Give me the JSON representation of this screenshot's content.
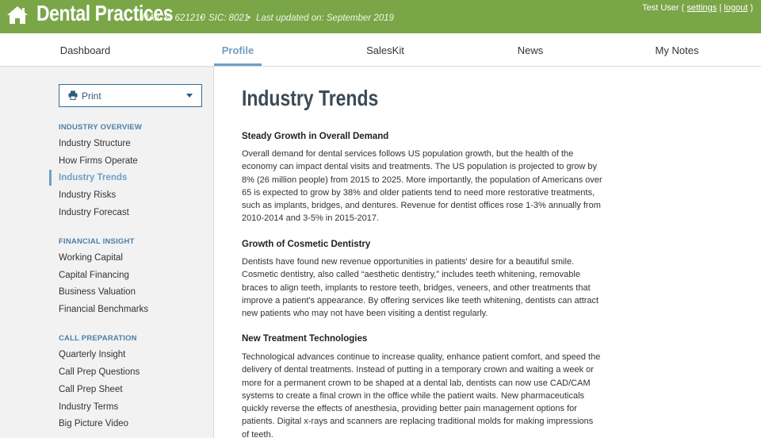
{
  "header": {
    "brand": "Dental Practices",
    "naics": "NAICS: 621210",
    "sic": "SIC: 8021",
    "last_updated": "Last updated on: September 2019",
    "separator": "•",
    "user_name": "Test User",
    "open_paren": " ( ",
    "settings_label": "settings",
    "pipe": " | ",
    "logout_label": "logout",
    "close_paren": " )",
    "colors": {
      "header_bg": "#7aa647",
      "accent_blue": "#6e9fc4"
    }
  },
  "nav": {
    "tabs": [
      {
        "label": "Dashboard"
      },
      {
        "label": "Profile"
      },
      {
        "label": "SalesKit"
      },
      {
        "label": "News"
      },
      {
        "label": "My Notes"
      }
    ],
    "active": "Profile"
  },
  "sidebar": {
    "print_label": "Print",
    "sections": [
      {
        "heading": "INDUSTRY OVERVIEW",
        "items": [
          "Industry Structure",
          "How Firms Operate",
          "Industry Trends",
          "Industry Risks",
          "Industry Forecast"
        ]
      },
      {
        "heading": "FINANCIAL INSIGHT",
        "items": [
          "Working Capital",
          "Capital Financing",
          "Business Valuation",
          "Financial Benchmarks"
        ]
      },
      {
        "heading": "CALL PREPARATION",
        "items": [
          "Quarterly Insight",
          "Call Prep Questions",
          "Call Prep Sheet",
          "Industry Terms",
          "Big Picture Video"
        ]
      }
    ],
    "active_item": "Industry Trends"
  },
  "main": {
    "title": "Industry Trends",
    "sections": [
      {
        "heading": "Steady Growth in Overall Demand",
        "body": "Overall demand for dental services follows US population growth, but the health of the economy can impact dental visits and treatments. The US population is projected to grow by 8% (26 million people) from 2015 to 2025. More importantly, the population of Americans over 65 is expected to grow by 38% and older patients tend to need more restorative treatments, such as implants, bridges, and dentures. Revenue for dentist offices rose 1-3% annually from 2010-2014 and 3-5% in 2015-2017."
      },
      {
        "heading": "Growth of Cosmetic Dentistry",
        "body": "Dentists have found new revenue opportunities in patients' desire for a beautiful smile. Cosmetic dentistry, also called “aesthetic dentistry,” includes teeth whitening, removable braces to align teeth, implants to restore teeth, bridges, veneers, and other treatments that improve a patient's appearance. By offering services like teeth whitening, dentists can attract new patients who may not have been visiting a dentist regularly."
      },
      {
        "heading": "New Treatment Technologies",
        "body": "Technological advances continue to increase quality, enhance patient comfort, and speed the delivery of dental treatments. Instead of putting in a temporary crown and waiting a week or more for a permanent crown to be shaped at a dental lab, dentists can now use CAD/CAM systems to create a final crown in the office while the patient waits. New pharmaceuticals quickly reverse the effects of anesthesia, providing better pain management options for patients. Digital x-rays and scanners are replacing traditional molds for making impressions of teeth."
      }
    ]
  }
}
